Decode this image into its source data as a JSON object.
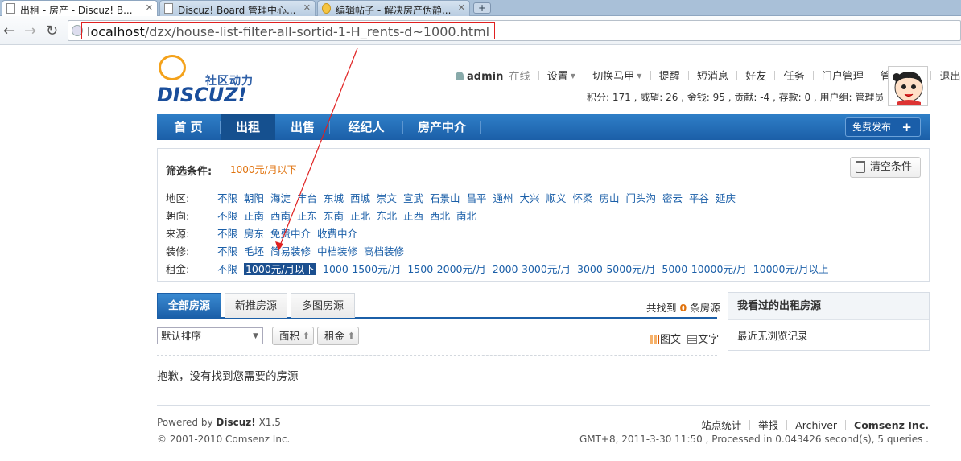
{
  "browser": {
    "tabs": [
      {
        "title": "出租 - 房产 - Discuz! B..."
      },
      {
        "title": "Discuz! Board 管理中心..."
      },
      {
        "title": "编辑帖子 - 解决房产伪静..."
      }
    ],
    "new_tab": "+",
    "url_host": "localhost",
    "url_path": "/dzx/house-list-filter-all-sortid-1-H_rents-d~1000.html"
  },
  "logo": {
    "tagline": "社区动力",
    "wordmark": "DISCUZ!"
  },
  "user": {
    "name": "admin",
    "status": "在线",
    "links": [
      "设置",
      "切换马甲",
      "提醒",
      "短消息",
      "好友",
      "任务",
      "门户管理",
      "管理中心",
      "退出"
    ],
    "stats": "积分: 171 , 威望: 26 , 金钱: 95 , 贡献: -4 , 存款: 0 , 用户组: 管理员"
  },
  "nav": {
    "items": [
      "首 页",
      "出租",
      "出售",
      "经纪人",
      "房产中介"
    ],
    "publish": "免费发布",
    "publish_plus": "+"
  },
  "filter": {
    "label": "筛选条件:",
    "current": "1000元/月以下",
    "clear": "清空条件",
    "rows": [
      {
        "key": "地区:",
        "options": [
          "不限",
          "朝阳",
          "海淀",
          "丰台",
          "东城",
          "西城",
          "崇文",
          "宣武",
          "石景山",
          "昌平",
          "通州",
          "大兴",
          "顺义",
          "怀柔",
          "房山",
          "门头沟",
          "密云",
          "平谷",
          "延庆"
        ]
      },
      {
        "key": "朝向:",
        "options": [
          "不限",
          "正南",
          "西南",
          "正东",
          "东南",
          "正北",
          "东北",
          "正西",
          "西北",
          "南北"
        ]
      },
      {
        "key": "来源:",
        "options": [
          "不限",
          "房东",
          "免费中介",
          "收费中介"
        ]
      },
      {
        "key": "装修:",
        "options": [
          "不限",
          "毛坯",
          "简易装修",
          "中档装修",
          "高档装修"
        ]
      },
      {
        "key": "租金:",
        "options": [
          "不限",
          "1000元/月以下",
          "1000-1500元/月",
          "1500-2000元/月",
          "2000-3000元/月",
          "3000-5000元/月",
          "5000-10000元/月",
          "10000元/月以上"
        ]
      }
    ]
  },
  "list": {
    "tabs": [
      "全部房源",
      "新推房源",
      "多图房源"
    ],
    "count_prefix": "共找到",
    "count": "0",
    "count_suffix": "条房源",
    "sort_default": "默认排序",
    "sort_area": "面积",
    "sort_rent": "租金",
    "view_pic": "图文",
    "view_text": "文字",
    "empty": "抱歉，没有找到您需要的房源"
  },
  "sidebar": {
    "title": "我看过的出租房源",
    "empty": "最近无浏览记录"
  },
  "footer": {
    "powered_prefix": "Powered by",
    "powered_brand": "Discuz!",
    "powered_version": "X1.5",
    "copyright": "© 2001-2010 Comsenz Inc.",
    "links": [
      "站点统计",
      "举报",
      "Archiver"
    ],
    "company": "Comsenz Inc.",
    "gmt": "GMT+8, 2011-3-30 11:50 , Processed in 0.043426 second(s), 5 queries ."
  },
  "colors": {
    "nav_blue": "#1b5fa8",
    "link_blue": "#1b5fa8",
    "accent_orange": "#e0720c",
    "annotation_red": "#e02020"
  }
}
